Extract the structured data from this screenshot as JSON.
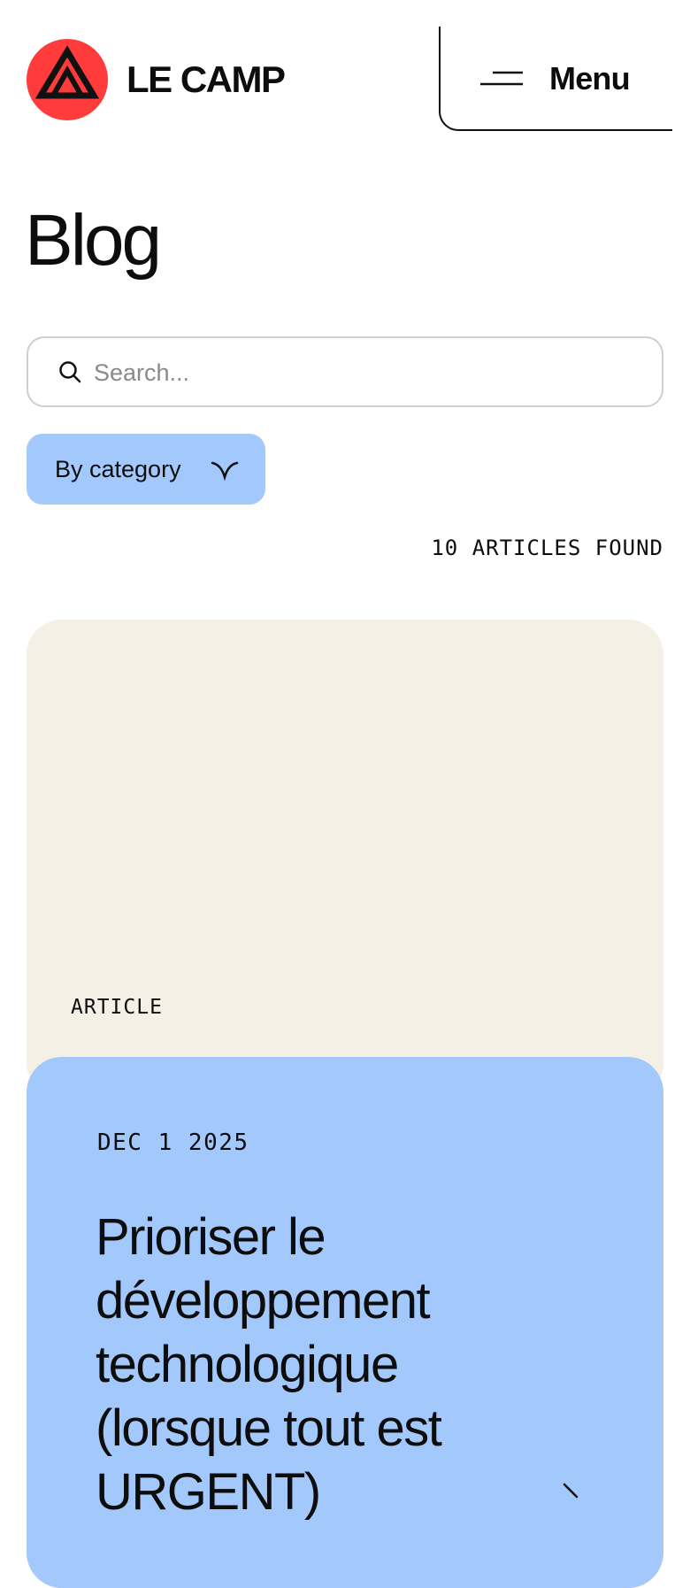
{
  "header": {
    "logo_icon": "camp-triangle-logo-icon",
    "brand": "LE CAMP",
    "menu_icon": "hamburger-menu-icon",
    "menu_label": "Menu"
  },
  "page": {
    "title": "Blog"
  },
  "search": {
    "icon": "search-icon",
    "placeholder": "Search..."
  },
  "filters": {
    "category_label": "By category",
    "category_icon": "chevron-down-icon"
  },
  "results": {
    "count_text": "10 ARTICLES FOUND"
  },
  "articles": [
    {
      "type": "ARTICLE",
      "date": "DEC 1 2025",
      "title": "Prioriser le développement technologique (lorsque tout est URGENT)",
      "arrow_icon": "arrow-right-icon"
    }
  ],
  "colors": {
    "brand_red": "#ff3b3b",
    "card_beige": "#f5f0e6",
    "accent_blue": "#a3c9fc",
    "text": "#0d0d0d"
  }
}
